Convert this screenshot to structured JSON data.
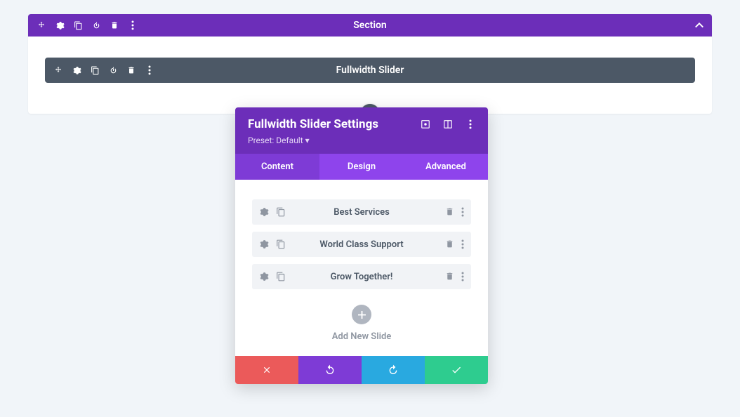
{
  "section": {
    "title": "Section"
  },
  "module": {
    "title": "Fullwidth Slider"
  },
  "panel": {
    "title": "Fullwidth Slider Settings",
    "preset": "Preset: Default ▾",
    "tabs": {
      "content": "Content",
      "design": "Design",
      "advanced": "Advanced"
    },
    "slides": [
      "Best Services",
      "World Class Support",
      "Grow Together!"
    ],
    "add_slide_label": "Add New Slide"
  }
}
